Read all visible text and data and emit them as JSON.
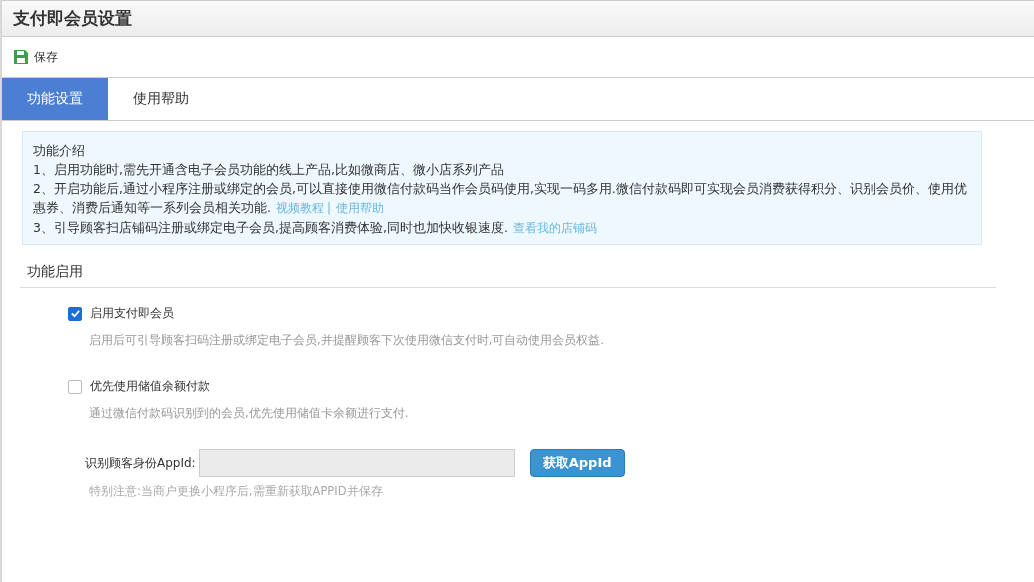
{
  "window": {
    "title": "支付即会员设置"
  },
  "toolbar": {
    "save": "保存"
  },
  "tabs": [
    {
      "label": "功能设置",
      "selected": true
    },
    {
      "label": "使用帮助",
      "selected": false
    }
  ],
  "intro": {
    "title": "功能介绍",
    "lines": [
      {
        "text": "1、启用功能时,需先开通含电子会员功能的线上产品,比如微商店、微小店系列产品"
      },
      {
        "text": "2、开启功能后,通过小程序注册或绑定的会员,可以直接使用微信付款码当作会员码使用,实现一码多用.微信付款码即可实现会员消费获得积分、识别会员价、使用优惠券、消费后通知等一系列会员相关功能.",
        "links": [
          "视频教程",
          "使用帮助"
        ],
        "separator": "|"
      },
      {
        "text": "3、引导顾客扫店铺码注册或绑定电子会员,提高顾客消费体验,同时也加快收银速度.",
        "links": [
          "查看我的店铺码"
        ]
      }
    ]
  },
  "section": {
    "title": "功能启用"
  },
  "options": [
    {
      "label": "启用支付即会员",
      "checked": true,
      "hint": "启用后可引导顾客扫码注册或绑定电子会员,并提醒顾客下次使用微信支付时,可自动使用会员权益."
    },
    {
      "label": "优先使用储值余额付款",
      "checked": false,
      "hint": "通过微信付款码识别到的会员,优先使用储值卡余额进行支付."
    }
  ],
  "appid": {
    "label": "识别顾客身份AppId:",
    "disabled": true,
    "button": "获取AppId",
    "note": "特别注意:当商户更换小程序后,需重新获取APPID并保存"
  }
}
